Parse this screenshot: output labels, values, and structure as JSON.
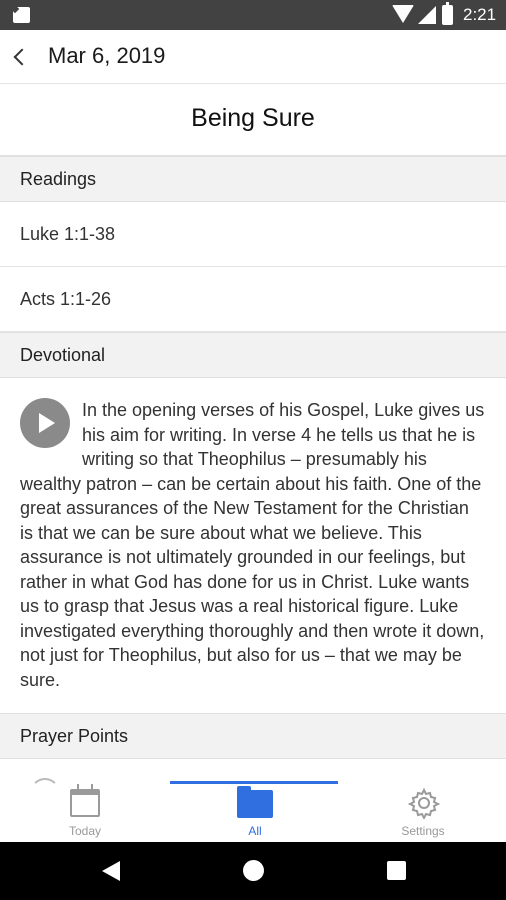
{
  "status_bar": {
    "time": "2:21",
    "icons": [
      "sd-card-icon",
      "wifi-icon",
      "signal-icon",
      "battery-icon"
    ]
  },
  "app_bar": {
    "back_icon": "back-arrow-icon",
    "date": "Mar 6, 2019"
  },
  "page": {
    "title": "Being Sure"
  },
  "sections": {
    "readings_header": "Readings",
    "readings": [
      "Luke 1:1-38",
      "Acts 1:1-26"
    ],
    "devotional_header": "Devotional",
    "devotional_text": "In the opening verses of his Gospel, Luke gives us his aim for writing. In verse 4 he tells us that he is writing so that Theophilus – presumably his wealthy patron – can be certain about his faith. One of the great assurances of the New Testament for the Christian is that we can be sure about what we believe. This assurance is not ultimately grounded in our feelings, but rather in what God has done for us in Christ. Luke wants us to grasp that Jesus was a real historical figure. Luke investigated everything thoroughly and then wrote it down, not just for Theophilus, but also for us – that we may be sure.",
    "prayer_header": "Prayer Points"
  },
  "bottom_nav": {
    "items": [
      {
        "label": "Today",
        "icon": "calendar-icon"
      },
      {
        "label": "All",
        "icon": "folder-icon",
        "active": true
      },
      {
        "label": "Settings",
        "icon": "gear-icon"
      }
    ]
  },
  "colors": {
    "accent": "#2f6fe0",
    "status_bar": "#424242",
    "section_bg": "#f2f2f2"
  }
}
